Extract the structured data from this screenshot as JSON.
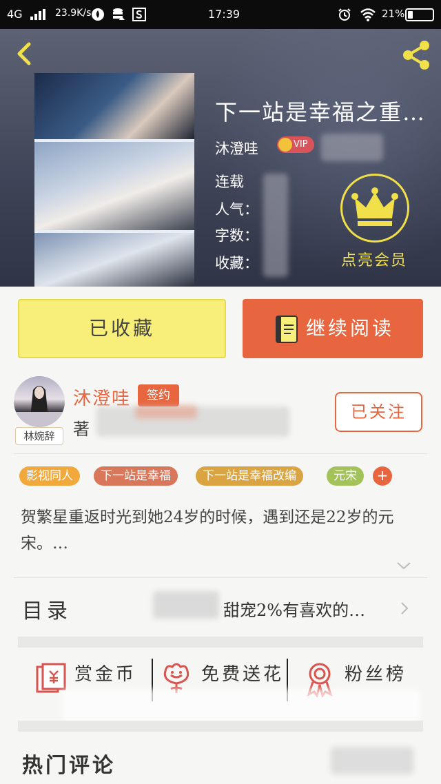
{
  "status_bar": {
    "network": "4G",
    "speed": "23.9K/s",
    "time": "17:39",
    "battery": "21%",
    "battery_level": 0.21
  },
  "book": {
    "title": "下一站是幸福之重…",
    "author": "沐澄哇",
    "vip_label": "VIP",
    "status": "连载",
    "popularity_label": "人气：",
    "word_count_label": "字数：",
    "favorites_label": "收藏："
  },
  "membership": {
    "label": "点亮会员",
    "icon": "crown-icon"
  },
  "actions": {
    "collected_label": "已收藏",
    "continue_label": "继续阅读"
  },
  "author_card": {
    "avatar_tag": "林婉辞",
    "name": "沐澄哇",
    "signed_badge": "签约",
    "suffix": "著",
    "follow_label": "已关注"
  },
  "tags": [
    {
      "label": "影视同人",
      "color": "#f2a93b"
    },
    {
      "label": "下一站是幸福",
      "color": "#d9775a"
    },
    {
      "label": "下一站是幸福改编",
      "color": "#d9a441"
    },
    {
      "label": "元宋",
      "color": "#a3c25a"
    }
  ],
  "tag_add": "+",
  "description": "贺繁星重返时光到她24岁的时候，遇到还是22岁的元宋。…",
  "catalog": {
    "label": "目录",
    "latest": "甜宠2%有喜欢的…"
  },
  "rewards": [
    {
      "label": "赏金币",
      "icon": "red-envelope-icon"
    },
    {
      "label": "免费送花",
      "icon": "flower-icon"
    },
    {
      "label": "粉丝榜",
      "icon": "medal-icon"
    }
  ],
  "hot_comments": {
    "title": "热门评论"
  },
  "colors": {
    "accent": "#e8663f",
    "collected_bg": "#f7ef7a",
    "member_gold": "#f2e04a"
  }
}
